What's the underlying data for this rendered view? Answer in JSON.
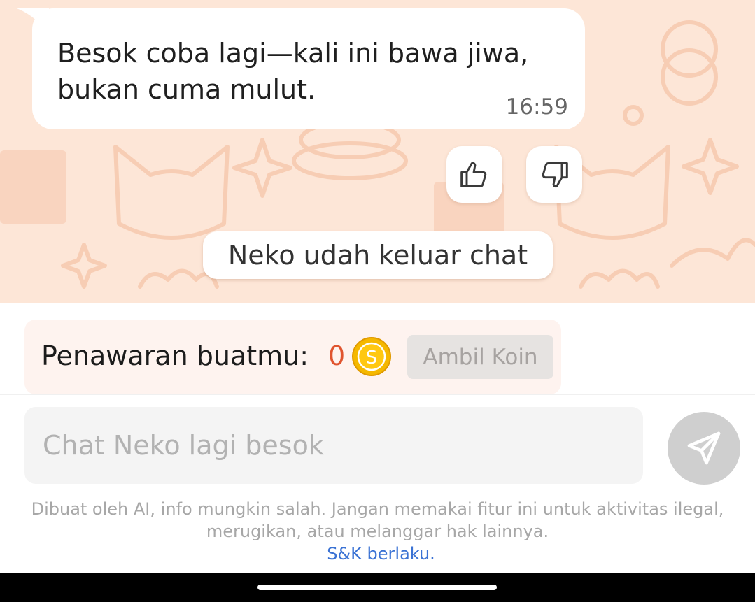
{
  "message": {
    "text": "Besok coba lagi—kali ini bawa jiwa, bukan cuma mulut.",
    "time": "16:59"
  },
  "reactions": {
    "like_icon": "thumbs-up-icon",
    "dislike_icon": "thumbs-down-icon"
  },
  "system_notice": "Neko udah keluar chat",
  "offer": {
    "label": "Penawaran buatmu:",
    "count": "0",
    "coin_symbol": "S",
    "claim_label": "Ambil Koin"
  },
  "composer": {
    "placeholder": "Chat Neko lagi besok",
    "send_icon": "send-icon"
  },
  "footer": {
    "disclaimer": "Dibuat oleh AI, info mungkin salah. Jangan memakai fitur ini untuk aktivitas ilegal, merugikan, atau melanggar hak lainnya.",
    "terms_link": "S&K berlaku."
  },
  "colors": {
    "chat_background": "#fde6d7",
    "accent_count": "#e0542f",
    "link": "#3a72d4",
    "coin": "#f5b800"
  }
}
